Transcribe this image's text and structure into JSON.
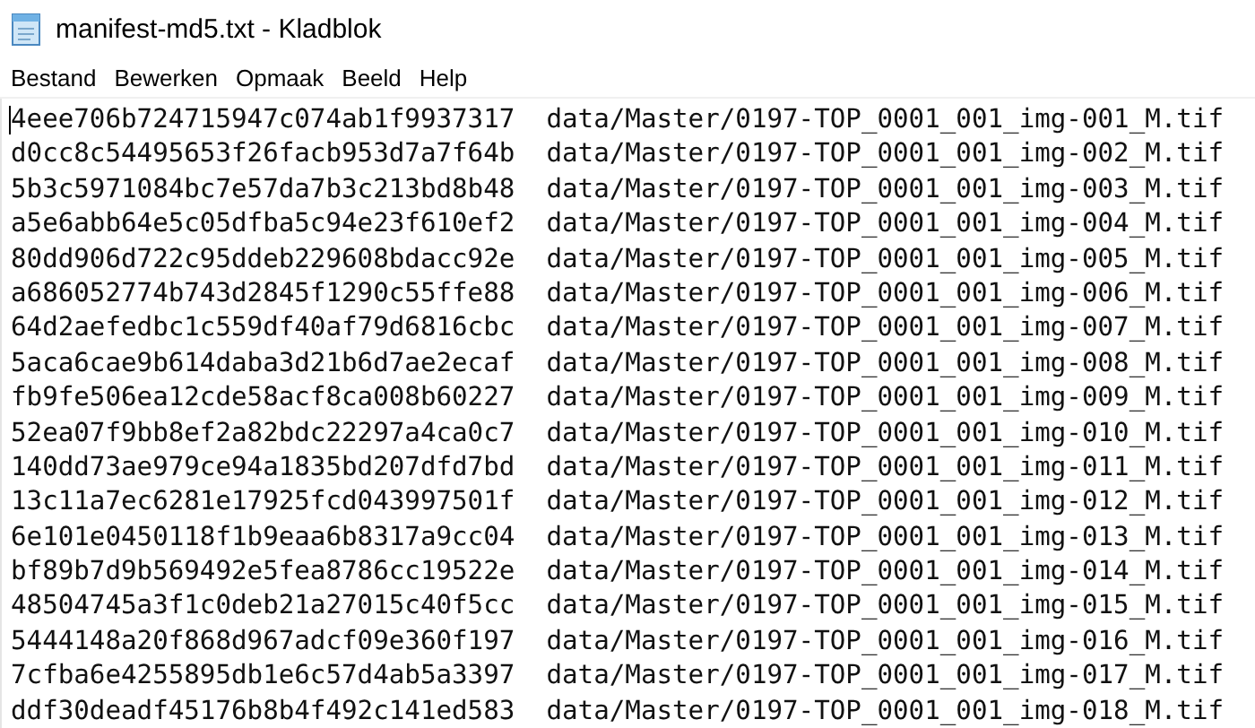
{
  "window": {
    "title": "manifest-md5.txt - Kladblok"
  },
  "menu": [
    "Bestand",
    "Bewerken",
    "Opmaak",
    "Beeld",
    "Help"
  ],
  "lines": [
    "4eee706b724715947c074ab1f9937317  data/Master/0197-TOP_0001_001_img-001_M.tif",
    "d0cc8c54495653f26facb953d7a7f64b  data/Master/0197-TOP_0001_001_img-002_M.tif",
    "5b3c5971084bc7e57da7b3c213bd8b48  data/Master/0197-TOP_0001_001_img-003_M.tif",
    "a5e6abb64e5c05dfba5c94e23f610ef2  data/Master/0197-TOP_0001_001_img-004_M.tif",
    "80dd906d722c95ddeb229608bdacc92e  data/Master/0197-TOP_0001_001_img-005_M.tif",
    "a686052774b743d2845f1290c55ffe88  data/Master/0197-TOP_0001_001_img-006_M.tif",
    "64d2aefedbc1c559df40af79d6816cbc  data/Master/0197-TOP_0001_001_img-007_M.tif",
    "5aca6cae9b614daba3d21b6d7ae2ecaf  data/Master/0197-TOP_0001_001_img-008_M.tif",
    "fb9fe506ea12cde58acf8ca008b60227  data/Master/0197-TOP_0001_001_img-009_M.tif",
    "52ea07f9bb8ef2a82bdc22297a4ca0c7  data/Master/0197-TOP_0001_001_img-010_M.tif",
    "140dd73ae979ce94a1835bd207dfd7bd  data/Master/0197-TOP_0001_001_img-011_M.tif",
    "13c11a7ec6281e17925fcd043997501f  data/Master/0197-TOP_0001_001_img-012_M.tif",
    "6e101e0450118f1b9eaa6b8317a9cc04  data/Master/0197-TOP_0001_001_img-013_M.tif",
    "bf89b7d9b569492e5fea8786cc19522e  data/Master/0197-TOP_0001_001_img-014_M.tif",
    "48504745a3f1c0deb21a27015c40f5cc  data/Master/0197-TOP_0001_001_img-015_M.tif",
    "5444148a20f868d967adcf09e360f197  data/Master/0197-TOP_0001_001_img-016_M.tif",
    "7cfba6e4255895db1e6c57d4ab5a3397  data/Master/0197-TOP_0001_001_img-017_M.tif",
    "ddf30deadf45176b8b4f492c141ed583  data/Master/0197-TOP_0001_001_img-018_M.tif"
  ]
}
